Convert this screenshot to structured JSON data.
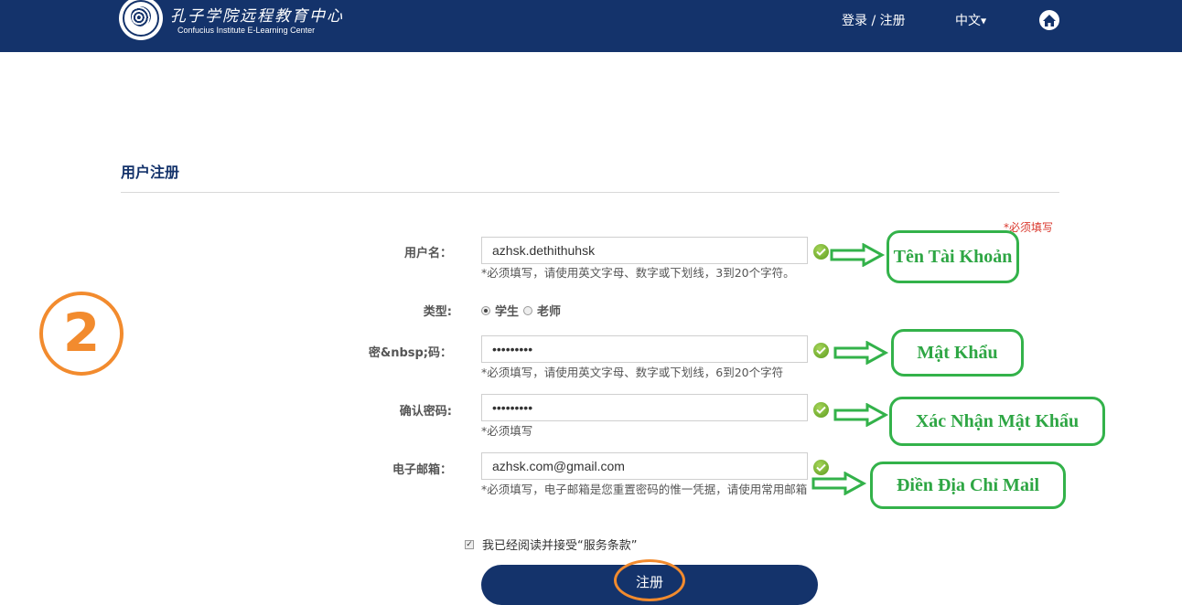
{
  "header": {
    "logo_cn": "孔子学院远程教育中心",
    "logo_en": "Confucius Institute E-Learning Center",
    "login_register": "登录 / 注册",
    "language": "中文",
    "home_icon": "home-icon"
  },
  "page": {
    "title": "用户注册",
    "required_note": "*必须填写"
  },
  "form": {
    "username": {
      "label": "用户名：",
      "value": "azhsk.dethithuhsk",
      "hint": "*必须填写，请使用英文字母、数字或下划线，3到20个字符。"
    },
    "type": {
      "label": "类型:",
      "options": [
        "学生",
        "老师"
      ],
      "selected": "学生"
    },
    "password": {
      "label": "密&nbsp;码：",
      "value": "•••••••••",
      "hint": "*必须填写，请使用英文字母、数字或下划线，6到20个字符"
    },
    "confirm_password": {
      "label": "确认密码:",
      "value": "•••••••••",
      "hint": "*必须填写"
    },
    "email": {
      "label": "电子邮箱：",
      "value": "azhsk.com@gmail.com",
      "hint": "*必须填写，电子邮箱是您重置密码的惟一凭据，请使用常用邮箱"
    },
    "agree": {
      "checked": true,
      "text": "我已经阅读并接受“服务条款”"
    },
    "submit_label": "注册"
  },
  "annotations": {
    "step_number": "2",
    "username": "Tên Tài Khoản",
    "password": "Mật Khẩu",
    "confirm_password": "Xác Nhận Mật Khẩu",
    "email": "Điền Địa Chỉ Mail"
  },
  "colors": {
    "header_bg": "#14336b",
    "annotation_green": "#33b24a",
    "annotation_orange": "#f28b2e",
    "required_red": "#d9362b",
    "valid_green": "#6aad2a"
  }
}
